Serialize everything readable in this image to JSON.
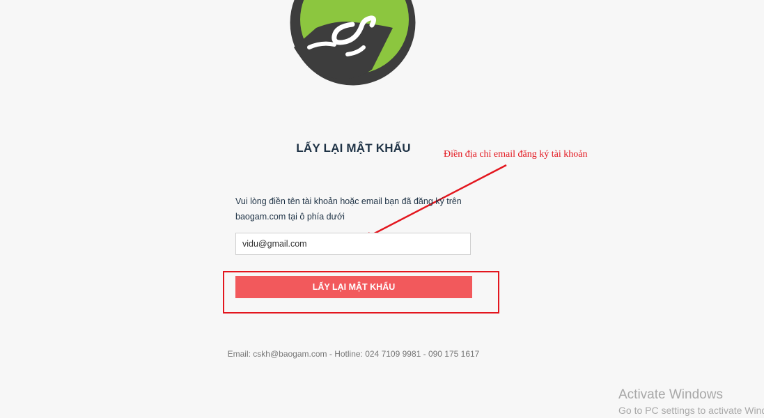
{
  "header": {
    "logo_name": "baogam-logo"
  },
  "form": {
    "title": "LẤY LẠI MẬT KHẨU",
    "description": "Vui lòng điền tên tài khoản hoặc email bạn đã đăng ký trên baogam.com tại ô phía dưới",
    "email_value": "vidu@gmail.com",
    "submit_label": "LẤY LẠI MẬT KHẨU"
  },
  "annotation": {
    "text": "Điền địa chỉ email đăng ký tài khoản",
    "color": "#e3161e"
  },
  "footer": {
    "contact": "Email: cskh@baogam.com - Hotline: 024 7109 9981 - 090 175 1617"
  },
  "os_watermark": {
    "title": "Activate Windows",
    "subtitle": "Go to PC settings to activate Windows."
  },
  "colors": {
    "background": "#f7f7f7",
    "button": "#f2595c",
    "title": "#1e3245",
    "logo_green": "#8cc63f",
    "logo_dark": "#3d3d3d"
  }
}
